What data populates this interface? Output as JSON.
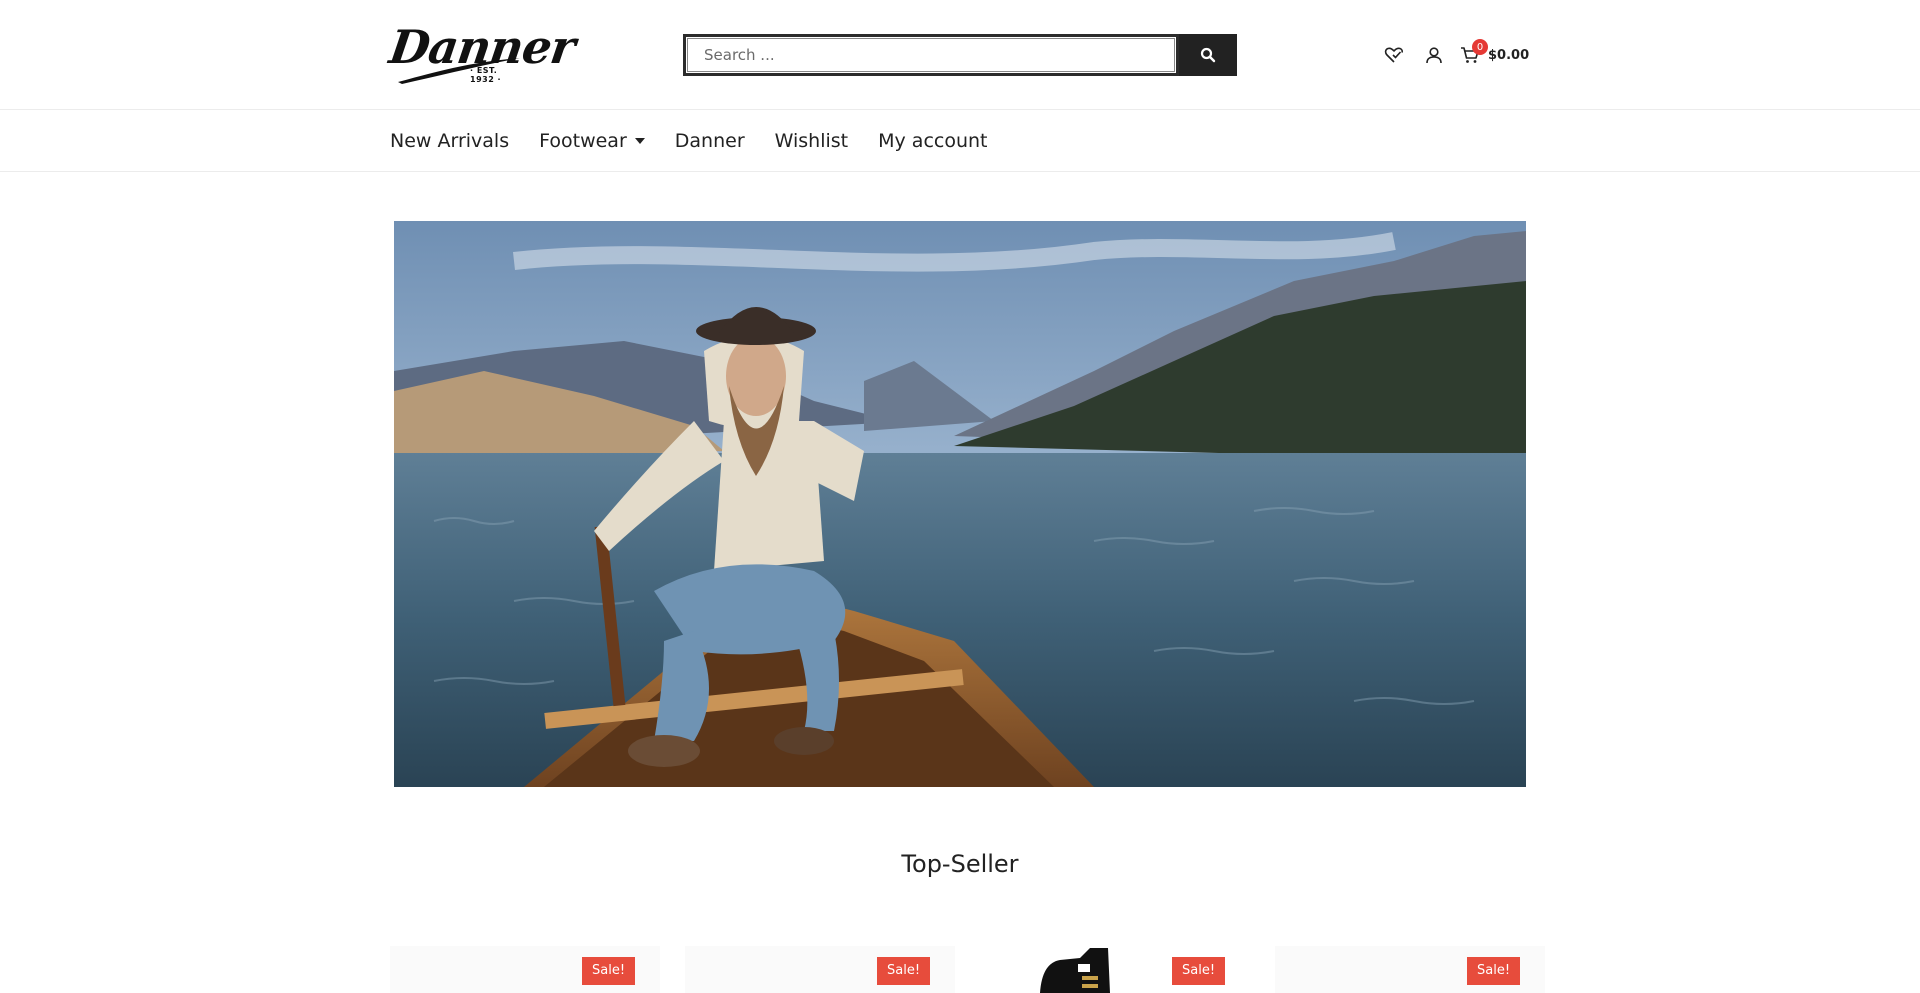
{
  "brand": {
    "logo_text": "Danner",
    "logo_tagline": "· EST. 1932 ·"
  },
  "search": {
    "placeholder": "Search ..."
  },
  "header_icons": [
    "wishlist-heart-icon",
    "user-icon",
    "cart-icon"
  ],
  "cart": {
    "count": "0",
    "total": "$0.00"
  },
  "nav": {
    "items": [
      {
        "label": "New Arrivals"
      },
      {
        "label": "Footwear"
      },
      {
        "label": "Danner"
      },
      {
        "label": "Wishlist"
      },
      {
        "label": "My account"
      }
    ]
  },
  "section": {
    "title": "Top-Seller"
  },
  "products": [
    {
      "badge": "Sale!"
    },
    {
      "badge": "Sale!"
    },
    {
      "badge": "Sale!"
    },
    {
      "badge": "Sale!"
    }
  ],
  "colors": {
    "sale": "#e74c3c",
    "badge": "#e53935",
    "search_button": "#222222"
  }
}
